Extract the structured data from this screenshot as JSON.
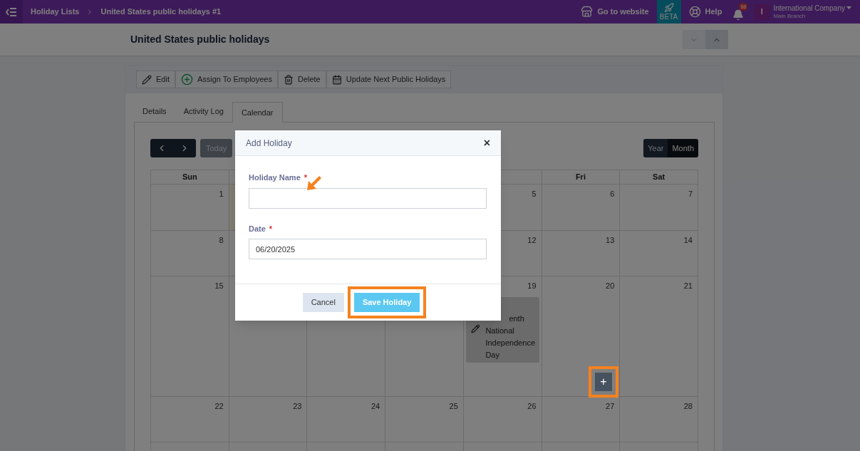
{
  "topbar": {
    "breadcrumbs": [
      {
        "label": "Holiday Lists"
      },
      {
        "label": "United States public holidays #1"
      }
    ],
    "actions": [
      {
        "kind": "store",
        "label": "Go to website"
      },
      {
        "kind": "beta",
        "label": "BETA"
      },
      {
        "kind": "help",
        "label": "Help"
      }
    ],
    "notifications": {
      "count": "68"
    },
    "account": {
      "initial": "I",
      "company": "International Company",
      "branch": "Main Branch"
    }
  },
  "page": {
    "title": "United States public holidays"
  },
  "toolbar": [
    {
      "kind": "edit",
      "label": "Edit"
    },
    {
      "kind": "assign",
      "label": "Assign To Employees"
    },
    {
      "kind": "delete",
      "label": "Delete"
    },
    {
      "kind": "update",
      "label": "Update Next Public Holidays"
    }
  ],
  "tabs": [
    {
      "label": "Details",
      "selected": false
    },
    {
      "label": "Activity Log",
      "selected": false
    },
    {
      "label": "Calendar",
      "selected": true
    }
  ],
  "calendar": {
    "today_button": "Today",
    "views": [
      {
        "label": "Year",
        "selected": false
      },
      {
        "label": "Month",
        "selected": true
      }
    ],
    "weekdays": {
      "left": [
        {
          "label": "Sun"
        }
      ],
      "right": [
        {
          "label": "Fri"
        },
        {
          "label": "Sat"
        }
      ]
    },
    "weeks": [
      {
        "left": [
          {
            "day": "1"
          },
          {
            "today": true
          }
        ],
        "right": [
          {
            "day": "5"
          },
          {
            "day": "6"
          },
          {
            "day": "7"
          }
        ]
      },
      {
        "left": [
          {
            "day": "8"
          }
        ],
        "right": [
          {
            "day": "12"
          },
          {
            "day": "13"
          },
          {
            "day": "14"
          }
        ]
      },
      {
        "left": [
          {
            "day": "15"
          }
        ],
        "right": [
          {
            "day": "19",
            "events": [
              {
                "title": "enth National Independence Day"
              }
            ]
          },
          {
            "day": "20"
          },
          {
            "day": "21"
          }
        ]
      },
      {
        "left": [
          {
            "day": "22"
          },
          {
            "day": "23"
          },
          {
            "day": "24"
          },
          {
            "day": "25"
          },
          {
            "day": "26"
          },
          {
            "day": "27"
          },
          {
            "day": "28"
          }
        ]
      }
    ],
    "add_button": {
      "label": "+",
      "highlighted": true
    }
  },
  "modal": {
    "title": "Add Holiday",
    "close": "×",
    "fields": [
      {
        "label": "Holiday Name",
        "required_mark": "*"
      },
      {
        "label": "Date",
        "required_mark": "*",
        "value": "06/20/2025"
      }
    ],
    "buttons": [
      {
        "kind": "cancel",
        "label": "Cancel",
        "highlighted": false
      },
      {
        "kind": "save",
        "label": "Save Holiday",
        "highlighted": true
      }
    ]
  }
}
